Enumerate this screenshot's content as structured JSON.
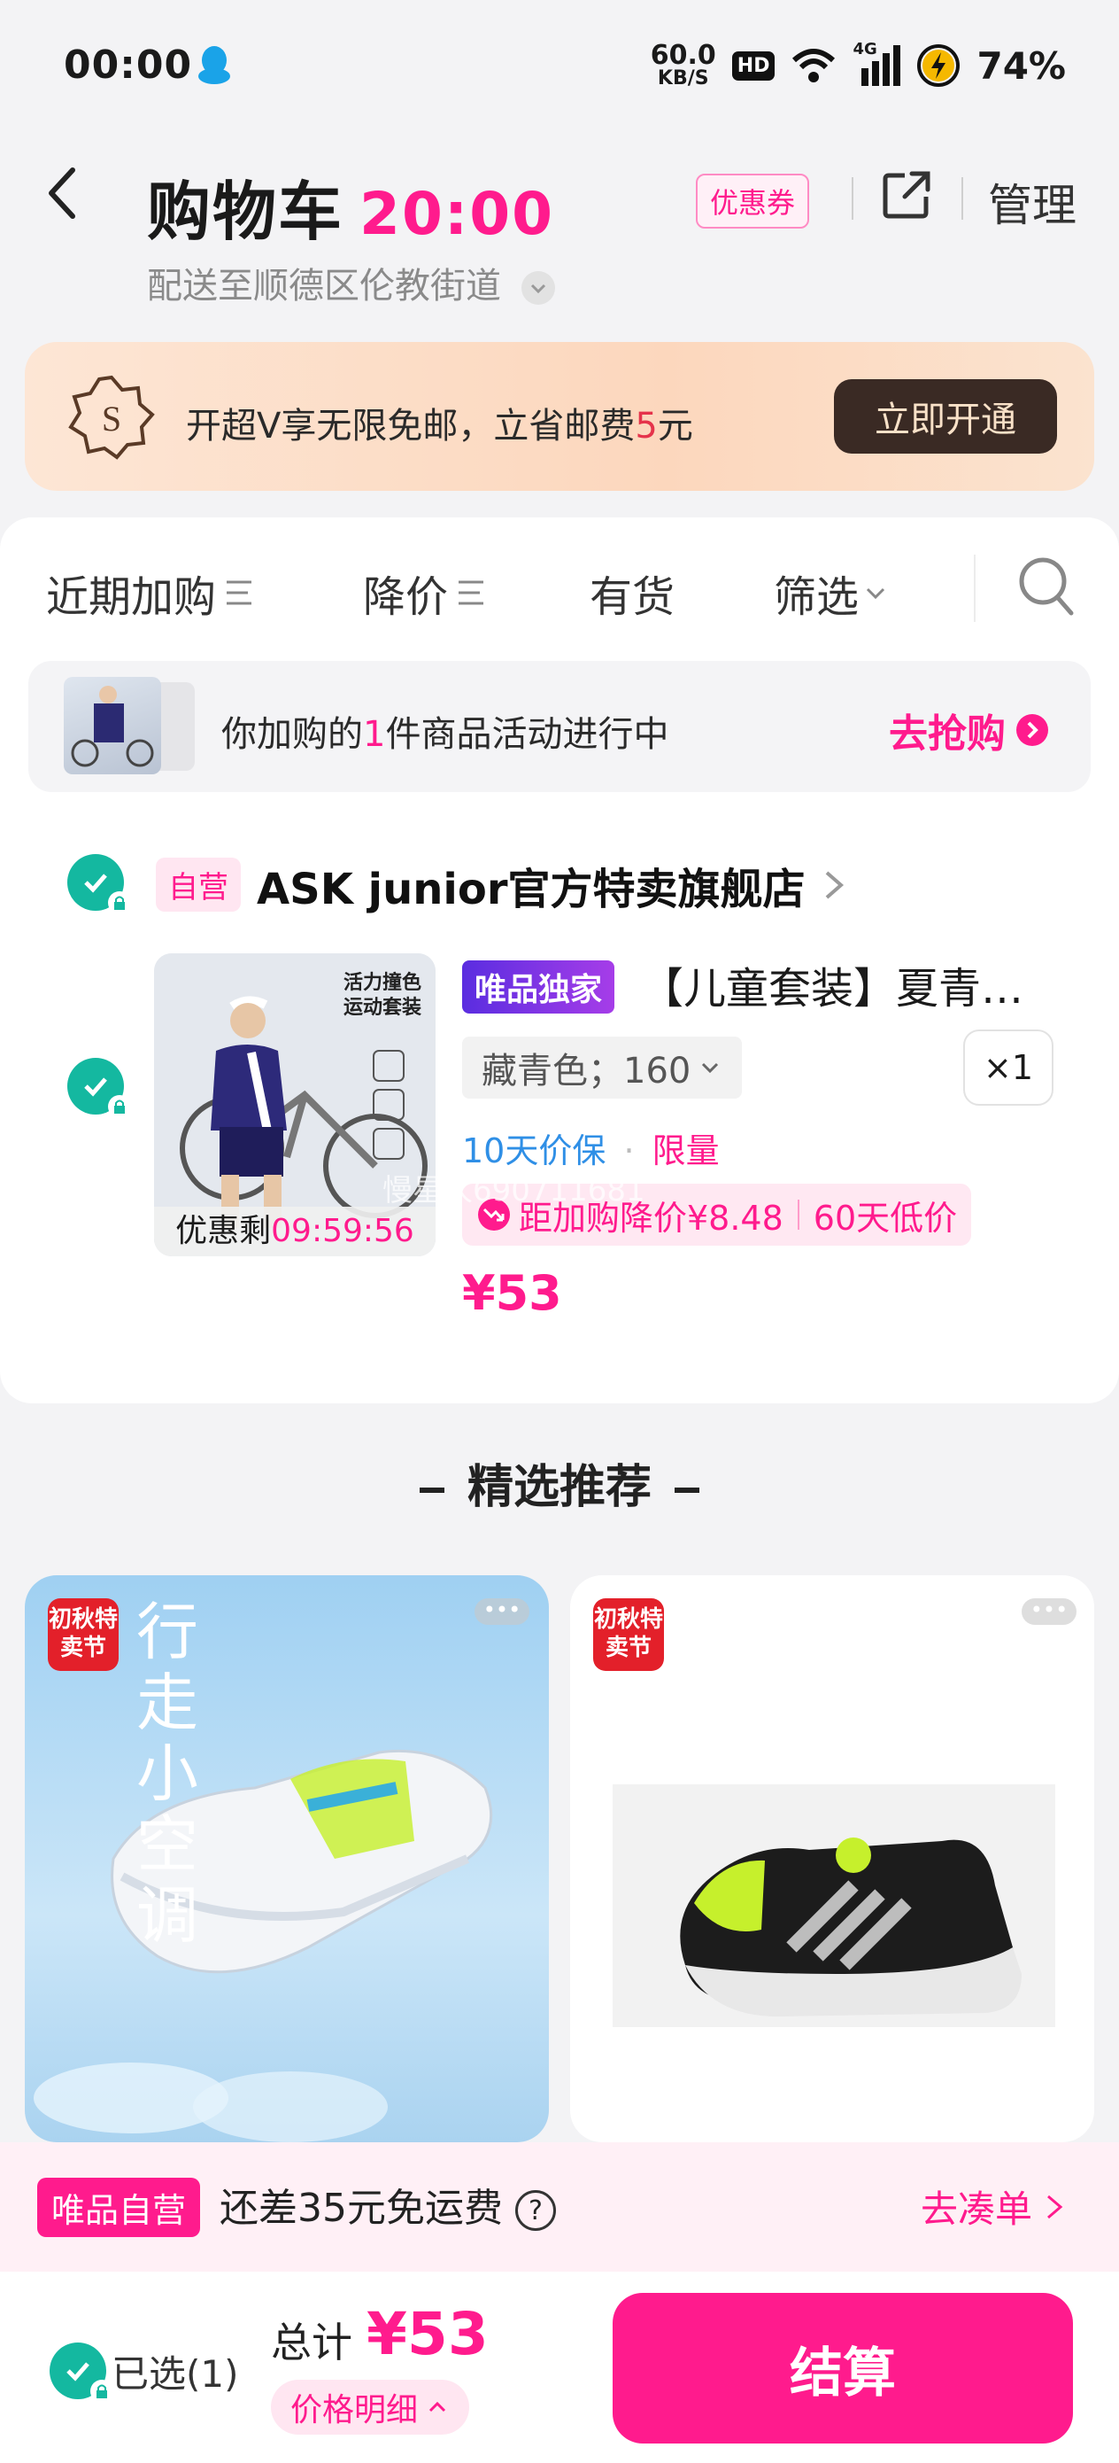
{
  "status_bar": {
    "time": "00:00",
    "net_speed_top": "60.0",
    "net_speed_unit": "KB/S",
    "hd": "HD",
    "network": "4G",
    "battery": "74%"
  },
  "header": {
    "title": "购物车",
    "countdown": "20:00",
    "coupon": "优惠券",
    "manage": "管理",
    "address": "配送至顺德区伦教街道"
  },
  "vip": {
    "text_before": "开超V享无限免邮，立省邮费",
    "amount": "5",
    "unit": "元",
    "button": "立即开通"
  },
  "filters": {
    "items": [
      "近期加购",
      "降价",
      "有货",
      "筛选"
    ]
  },
  "promo": {
    "text_before": "你加购的",
    "count": "1",
    "text_after": "件商品活动进行中",
    "go": "去抢购"
  },
  "store": {
    "badge": "自营",
    "name": "ASK junior官方特卖旗舰店"
  },
  "product": {
    "image_caption_label": "优惠剩",
    "image_caption_time": "09:59:56",
    "image_text_lines": [
      "活力撞色",
      "运动套装"
    ],
    "exclusive_badge": "唯品独家",
    "name": "【儿童套装】夏青少年男童运动套装",
    "spec": "藏青色；160",
    "qty": "×1",
    "tag_guarantee": "10天价保",
    "tag_limit": "限量",
    "price_drop": "距加购降价¥8.48",
    "low_price": "60天低价",
    "price": "¥53",
    "watermark": "慢星人690711681"
  },
  "recommend": {
    "title": "精选推荐",
    "cards": [
      {
        "tag": "初秋特卖节",
        "overlay_text": "行走小空调",
        "bg": "#bfe0f6"
      },
      {
        "tag": "初秋特卖节",
        "bg": "#ffffff"
      }
    ]
  },
  "shipping": {
    "badge": "唯品自营",
    "text": "还差35元免运费",
    "help": "?",
    "go": "去凑单"
  },
  "bottom": {
    "selected": "已选(1)",
    "total_label": "总计",
    "total": "¥53",
    "detail": "价格明细",
    "checkout": "结算"
  },
  "colors": {
    "brand": "#ff1b8d",
    "check": "#14b8a0",
    "vip_btn": "#3a2a24"
  }
}
